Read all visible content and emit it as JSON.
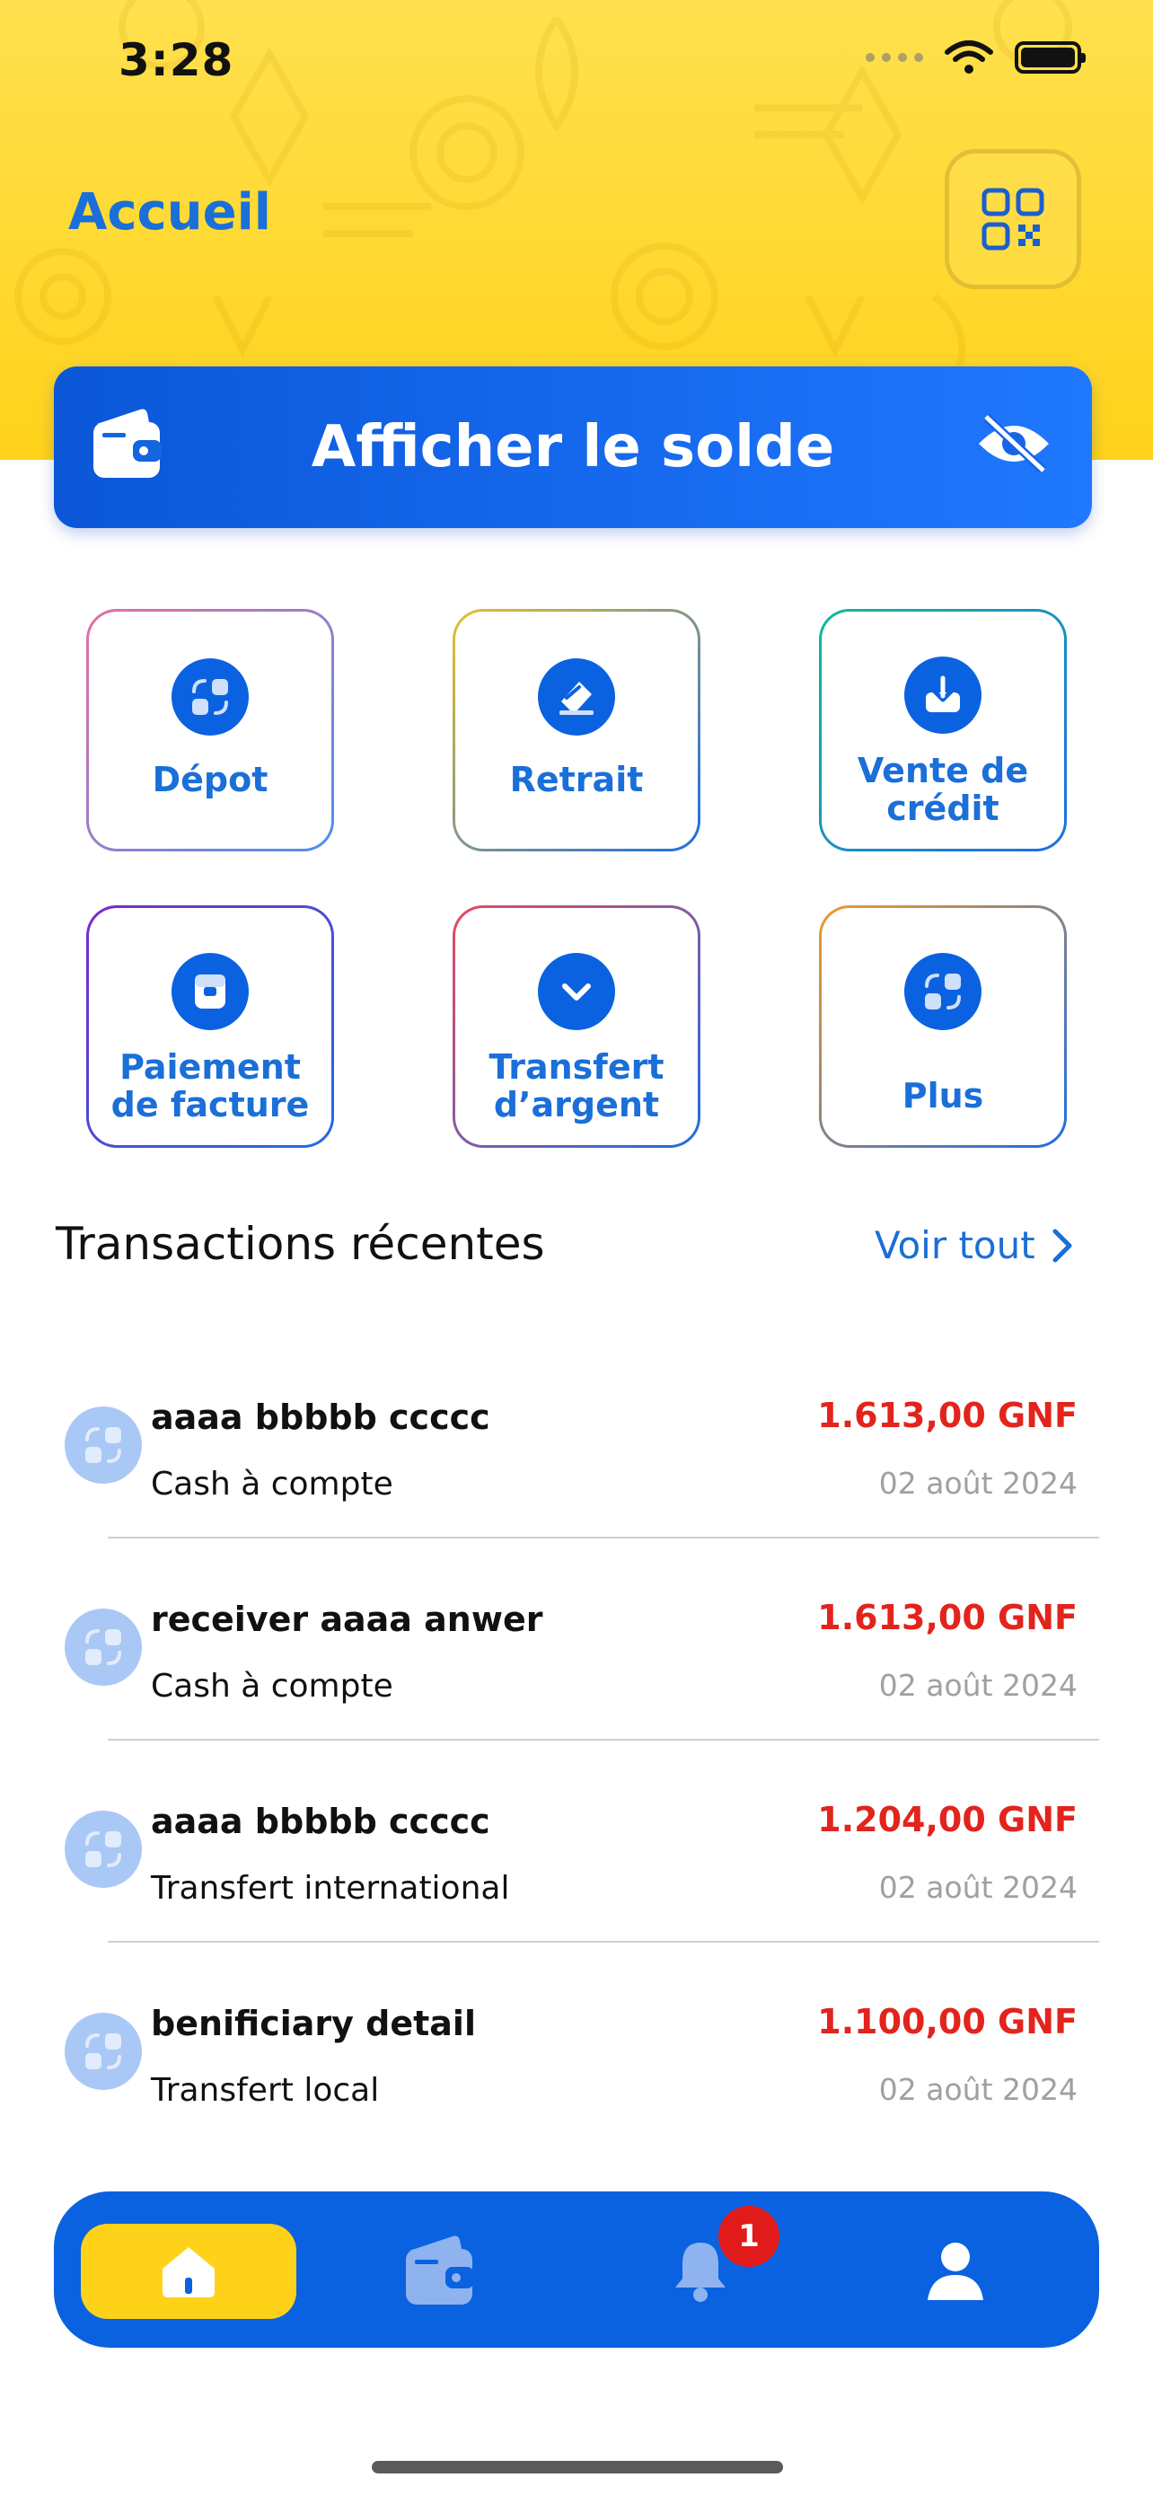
{
  "status_bar": {
    "time": "3:28"
  },
  "header": {
    "title": "Accueil",
    "qr_icon": "qr-code-icon"
  },
  "balance": {
    "label": "Afficher le solde",
    "wallet_icon": "wallet-icon",
    "eye_icon": "eye-off-icon"
  },
  "services": [
    {
      "label": "Dépot",
      "icon": "exchange-icon"
    },
    {
      "label": "Retrait",
      "icon": "eraser-icon"
    },
    {
      "label": "Vente de crédit",
      "icon": "download-tray-icon"
    },
    {
      "label": "Paiement de facture",
      "icon": "store-icon"
    },
    {
      "label": "Transfert d’argent",
      "icon": "chevron-down-icon"
    },
    {
      "label": "Plus",
      "icon": "exchange-icon"
    }
  ],
  "recent": {
    "title": "Transactions récentes",
    "see_all": "Voir tout",
    "items": [
      {
        "name": "aaaa bbbbb ccccc",
        "type": "Cash à compte",
        "amount": "1.613,00 GNF",
        "date": "02 août 2024"
      },
      {
        "name": "receiver aaaa anwer",
        "type": "Cash à compte",
        "amount": "1.613,00 GNF",
        "date": "02 août 2024"
      },
      {
        "name": "aaaa bbbbb ccccc",
        "type": "Transfert international",
        "amount": "1.204,00 GNF",
        "date": "02 août 2024"
      },
      {
        "name": "benificiary detail",
        "type": "Transfert local",
        "amount": "1.100,00 GNF",
        "date": "02 août 2024"
      }
    ]
  },
  "nav": {
    "items": [
      {
        "icon": "home-icon",
        "active": true
      },
      {
        "icon": "wallet-icon",
        "active": false
      },
      {
        "icon": "bell-icon",
        "active": false,
        "badge": "1"
      },
      {
        "icon": "user-icon",
        "active": false
      }
    ]
  },
  "colors": {
    "brand_blue": "#0a62e0",
    "brand_yellow": "#ffd21a",
    "amount_red": "#e2241c"
  }
}
